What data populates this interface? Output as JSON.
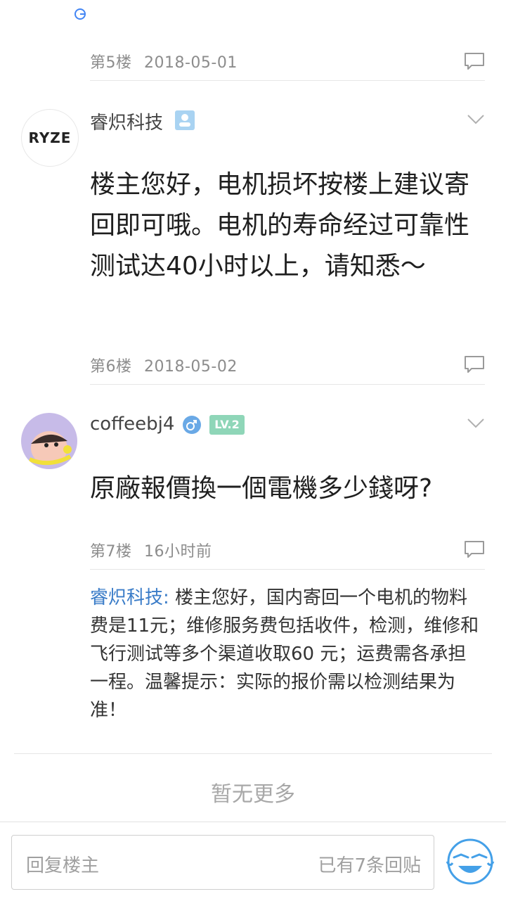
{
  "posts": [
    {
      "floor": "第5楼",
      "time": "2018-05-01"
    },
    {
      "avatar_text": "RYZE",
      "username": "睿炽科技",
      "content": "楼主您好，电机损坏按楼上建议寄回即可哦。电机的寿命经过可靠性测试达40小时以上，请知悉～",
      "floor": "第6楼",
      "time": "2018-05-02"
    },
    {
      "username": "coffeebj4",
      "level_badge": "LV.2",
      "content": "原廠報價換一個電機多少錢呀?",
      "floor": "第7楼",
      "time": "16小时前",
      "reply": {
        "author": "睿炽科技:",
        "text": " 楼主您好，国内寄回一个电机的物料费是11元；维修服务费包括收件，检测，维修和飞行测试等多个渠道收取60 元；运费需各承担一程。温馨提示：实际的报价需以检测结果为准！"
      }
    }
  ],
  "end_text": "暂无更多",
  "reply_input": {
    "placeholder": "回复楼主",
    "count_text": "已有7条回贴"
  },
  "icons": {
    "comment": "comment-icon",
    "chevron": "chevron-down-icon",
    "verified": "verified-badge-icon",
    "gender": "male-icon",
    "emoji": "emoji-icon"
  },
  "colors": {
    "accent": "#3a7cc8",
    "level_badge": "#8fd6b8",
    "gender": "#6aa9e6",
    "emoji": "#44a0e8"
  }
}
